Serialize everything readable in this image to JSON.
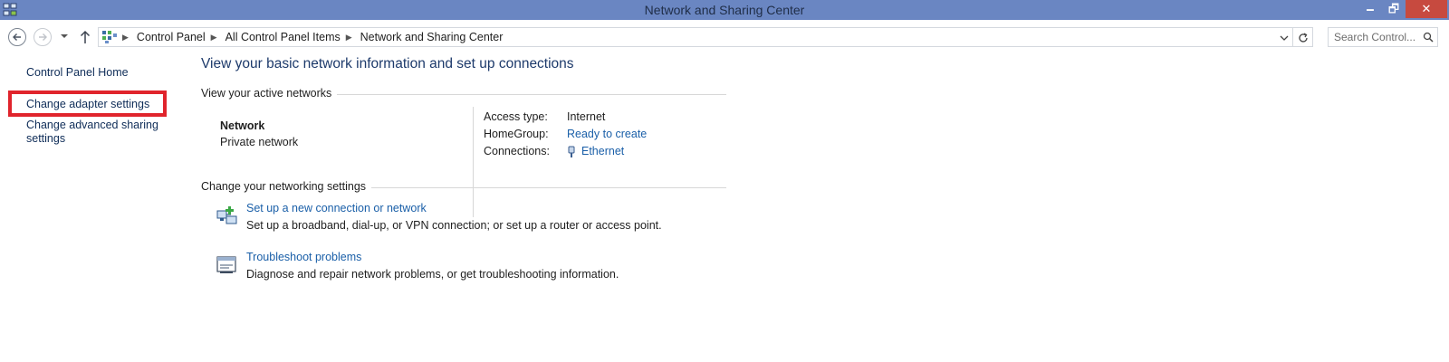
{
  "window": {
    "title": "Network and Sharing Center",
    "controls": {
      "minimize": "🗕",
      "maximize": "🗗",
      "close": "✕"
    },
    "icon": "network-sharing-icon"
  },
  "address": {
    "breadcrumbs": [
      "Control Panel",
      "All Control Panel Items",
      "Network and Sharing Center"
    ],
    "search_placeholder": "Search Control..."
  },
  "left_pane": {
    "home": "Control Panel Home",
    "change_adapter": "Change adapter settings",
    "change_advanced": "Change advanced sharing settings",
    "highlighted_item": "change_adapter",
    "highlight_color": "#e0242c"
  },
  "main": {
    "heading": "View your basic network information and set up connections",
    "active_networks_label": "View your active networks",
    "network": {
      "name": "Network",
      "type": "Private network"
    },
    "properties": {
      "access_type_label": "Access type:",
      "access_type_value": "Internet",
      "homegroup_label": "HomeGroup:",
      "homegroup_value": "Ready to create",
      "connections_label": "Connections:",
      "connections_value": "Ethernet"
    },
    "settings_label": "Change your networking settings",
    "tasks": [
      {
        "title": "Set up a new connection or network",
        "description": "Set up a broadband, dial-up, or VPN connection; or set up a router or access point.",
        "icon": "new-connection-icon"
      },
      {
        "title": "Troubleshoot problems",
        "description": "Diagnose and repair network problems, or get troubleshooting information.",
        "icon": "troubleshoot-icon"
      }
    ]
  },
  "colors": {
    "titlebar": "#6a86c2",
    "link": "#1a5fa8",
    "heading": "#1d3a6b",
    "nav_link": "#0f2d58",
    "close_button": "#c74a3f"
  }
}
